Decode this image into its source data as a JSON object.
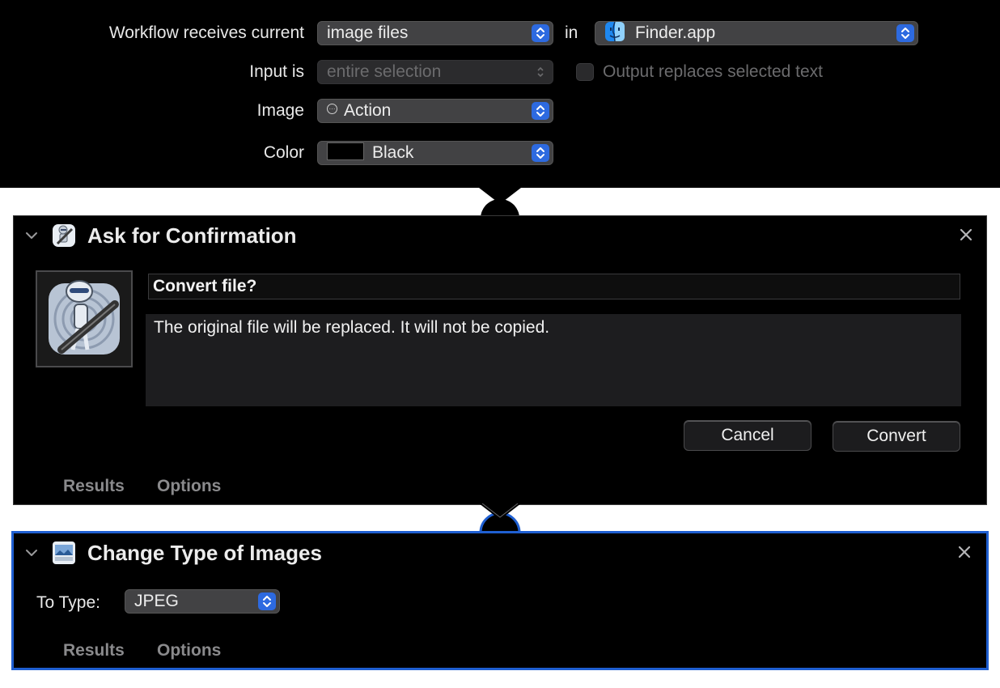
{
  "header": {
    "receives_label": "Workflow receives current",
    "receives_value": "image files",
    "in_label": "in",
    "app_value": "Finder.app",
    "input_label": "Input is",
    "input_value": "entire selection",
    "output_checkbox_label": "Output replaces selected text",
    "image_label": "Image",
    "image_value": "Action",
    "color_label": "Color",
    "color_value": "Black"
  },
  "ask_block": {
    "title": "Ask for Confirmation",
    "message_title": "Convert file?",
    "message_body": "The original file will be replaced. It will not be copied.",
    "cancel_label": "Cancel",
    "convert_label": "Convert",
    "tab_results": "Results",
    "tab_options": "Options"
  },
  "change_block": {
    "title": "Change Type of Images",
    "to_type_label": "To Type:",
    "to_type_value": "JPEG",
    "tab_results": "Results",
    "tab_options": "Options"
  },
  "colors": {
    "accent": "#2d6ae0",
    "selected_border": "#1f5fd1",
    "background": "#000000"
  },
  "icons": [
    "finder-icon",
    "action-icon",
    "automator-icon",
    "image-icon",
    "chevron-down-icon",
    "close-icon",
    "stepper-icon"
  ]
}
